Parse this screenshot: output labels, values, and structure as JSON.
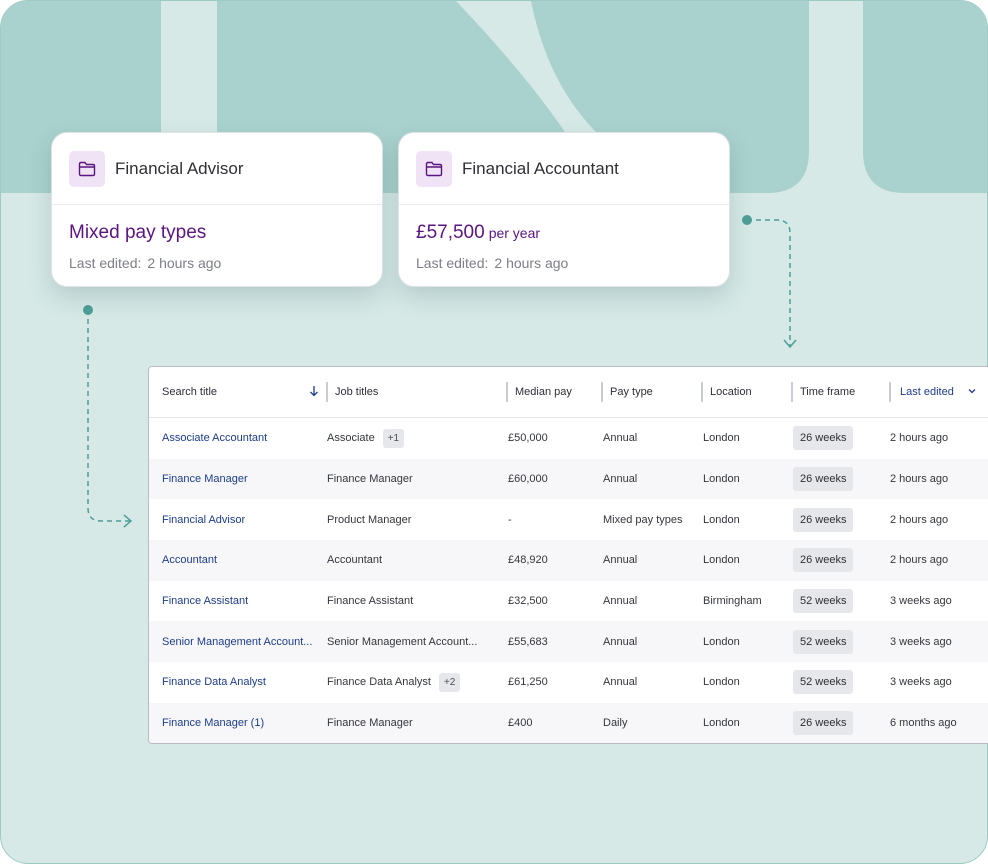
{
  "cards": [
    {
      "title": "Financial Advisor",
      "value": "Mixed pay types",
      "unit": "",
      "meta_label": "Last edited:",
      "meta_value": "2 hours ago"
    },
    {
      "title": "Financial Accountant",
      "value": "£57,500",
      "unit": "per year",
      "meta_label": "Last edited:",
      "meta_value": "2 hours ago"
    }
  ],
  "table": {
    "headers": [
      "Search title",
      "Job titles",
      "Median pay",
      "Pay type",
      "Location",
      "Time frame",
      "Last edited"
    ],
    "rows": [
      {
        "title": "Associate Accountant",
        "job": "Associate",
        "extra": "+1",
        "pay": "£50,000",
        "type": "Annual",
        "location": "London",
        "timeframe": "26 weeks",
        "edited": "2 hours ago"
      },
      {
        "title": "Finance Manager",
        "job": "Finance Manager",
        "extra": "",
        "pay": "£60,000",
        "type": "Annual",
        "location": "London",
        "timeframe": "26 weeks",
        "edited": "2 hours ago"
      },
      {
        "title": "Financial Advisor",
        "job": "Product Manager",
        "extra": "",
        "pay": "-",
        "type": "Mixed pay types",
        "location": "London",
        "timeframe": "26 weeks",
        "edited": "2 hours ago"
      },
      {
        "title": "Accountant",
        "job": "Accountant",
        "extra": "",
        "pay": "£48,920",
        "type": "Annual",
        "location": "London",
        "timeframe": "26 weeks",
        "edited": "2 hours ago"
      },
      {
        "title": "Finance Assistant",
        "job": "Finance Assistant",
        "extra": "",
        "pay": "£32,500",
        "type": "Annual",
        "location": "Birmingham",
        "timeframe": "52 weeks",
        "edited": "3 weeks ago"
      },
      {
        "title": "Senior Management Account...",
        "job": "Senior Management Account...",
        "extra": "",
        "pay": "£55,683",
        "type": "Annual",
        "location": "London",
        "timeframe": "52 weeks",
        "edited": "3 weeks ago"
      },
      {
        "title": "Finance Data Analyst",
        "job": "Finance Data Analyst",
        "extra": "+2",
        "pay": "£61,250",
        "type": "Annual",
        "location": "London",
        "timeframe": "52 weeks",
        "edited": "3 weeks ago"
      },
      {
        "title": "Finance Manager (1)",
        "job": "Finance Manager",
        "extra": "",
        "pay": "£400",
        "type": "Daily",
        "location": "London",
        "timeframe": "26 weeks",
        "edited": "6 months ago"
      }
    ]
  },
  "icons": {
    "card": "folder-icon",
    "sort": "arrow-down-icon",
    "dropdown": "chevron-down-icon"
  },
  "colors": {
    "accent_purple": "#5a1580",
    "link_blue": "#1d3d8a",
    "teal": "#4e9e98",
    "background": "#d6e9e7"
  }
}
